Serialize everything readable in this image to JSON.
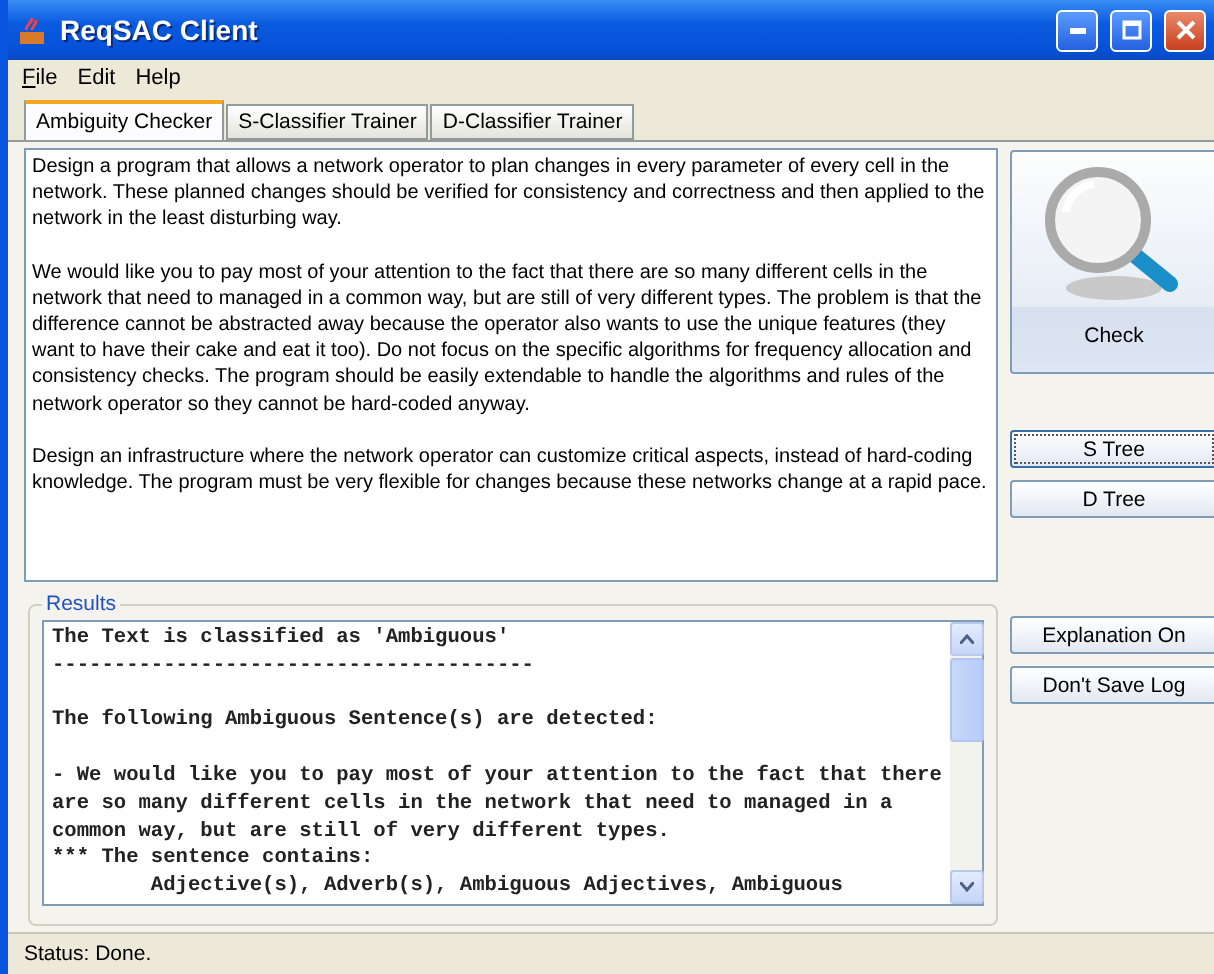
{
  "window": {
    "title": "ReqSAC Client"
  },
  "menu": [
    {
      "label": "File",
      "first_letter_underlined": true
    },
    {
      "label": "Edit",
      "first_letter_underlined": false
    },
    {
      "label": "Help",
      "first_letter_underlined": false
    }
  ],
  "tabs": [
    {
      "label": "Ambiguity Checker",
      "selected": true
    },
    {
      "label": "S-Classifier Trainer",
      "selected": false
    },
    {
      "label": "D-Classifier Trainer",
      "selected": false
    }
  ],
  "input_text": [
    "Design a program that allows a network operator to plan changes in every parameter of every cell in the network. These planned changes should be verified for consistency and correctness and then applied to the network in the least disturbing way.",
    "We would like you to pay most of your attention to the fact that there are so many different cells in the network that need to managed in a common way, but are still of very different types. The problem is that the difference cannot be abstracted away because the operator also wants to use the unique features (they want to have their cake and eat it too). Do not focus on the specific algorithms for frequency allocation and consistency checks. The program should be easily extendable to handle the algorithms and rules of the network operator so they cannot be hard-coded anyway.",
    "Design an infrastructure where the network operator can customize critical aspects, instead of hard-coding knowledge. The program must be very flexible for changes because these networks change at a rapid pace."
  ],
  "check_button": {
    "label": "Check"
  },
  "tree_buttons": [
    {
      "label": "S Tree",
      "focused": true
    },
    {
      "label": "D Tree",
      "focused": false
    }
  ],
  "results": {
    "title": "Results",
    "lines": [
      {
        "text": "The Text is classified as 'Ambiguous'",
        "blank_before": false
      },
      {
        "text": "---------------------------------------",
        "blank_before": false
      },
      {
        "text": "The following Ambiguous Sentence(s) are detected:",
        "blank_before": true
      },
      {
        "text": "- We would like you to pay most of your attention to the fact that there",
        "blank_before": true
      },
      {
        "text": "are so many different cells in the network that need to managed in a",
        "blank_before": false
      },
      {
        "text": "common way, but are still of very different types.",
        "blank_before": false
      },
      {
        "text": "*** The sentence contains:",
        "blank_before": false
      },
      {
        "text": "        Adjective(s), Adverb(s), Ambiguous Adjectives, Ambiguous",
        "blank_before": false
      }
    ]
  },
  "option_buttons": [
    {
      "label": "Explanation On"
    },
    {
      "label": "Don't Save Log"
    }
  ],
  "status_bar": "Status: Done."
}
